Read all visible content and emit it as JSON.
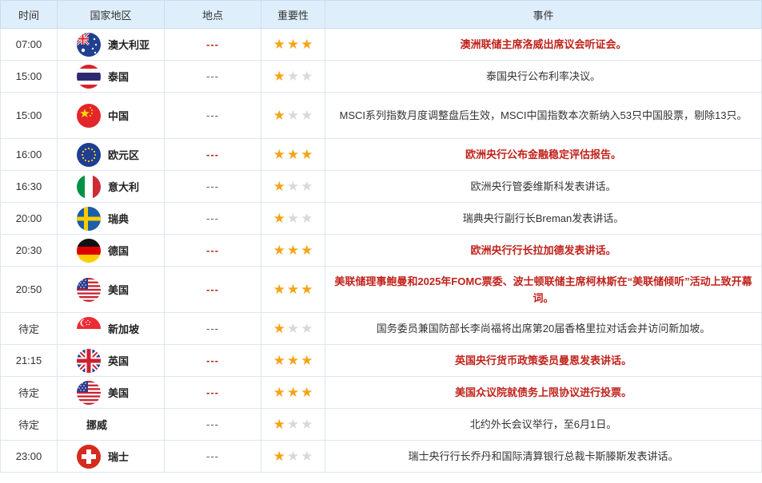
{
  "headers": {
    "time": "时间",
    "country": "国家地区",
    "place": "地点",
    "importance": "重要性",
    "event": "事件"
  },
  "rows": [
    {
      "time": "07:00",
      "country": "澳大利亚",
      "flag": "australia-flag-icon",
      "place": "---",
      "stars": 3,
      "event": "澳洲联储主席洛威出席议会听证会。",
      "highlight": true
    },
    {
      "time": "15:00",
      "country": "泰国",
      "flag": "thailand-flag-icon",
      "place": "---",
      "stars": 1,
      "event": "泰国央行公布利率决议。",
      "highlight": false
    },
    {
      "time": "15:00",
      "country": "中国",
      "flag": "china-flag-icon",
      "place": "---",
      "stars": 1,
      "event": "MSCI系列指数月度调整盘后生效，MSCI中国指数本次新纳入53只中国股票，剔除13只。",
      "highlight": false
    },
    {
      "time": "16:00",
      "country": "欧元区",
      "flag": "eu-flag-icon",
      "place": "---",
      "stars": 3,
      "event": "欧洲央行公布金融稳定评估报告。",
      "highlight": true
    },
    {
      "time": "16:30",
      "country": "意大利",
      "flag": "italy-flag-icon",
      "place": "---",
      "stars": 1,
      "event": "欧洲央行管委维斯科发表讲话。",
      "highlight": false
    },
    {
      "time": "20:00",
      "country": "瑞典",
      "flag": "sweden-flag-icon",
      "place": "---",
      "stars": 1,
      "event": "瑞典央行副行长Breman发表讲话。",
      "highlight": false
    },
    {
      "time": "20:30",
      "country": "德国",
      "flag": "germany-flag-icon",
      "place": "---",
      "stars": 3,
      "event": "欧洲央行行长拉加德发表讲话。",
      "highlight": true
    },
    {
      "time": "20:50",
      "country": "美国",
      "flag": "usa-flag-icon",
      "place": "---",
      "stars": 3,
      "event": "美联储理事鲍曼和2025年FOMC票委、波士顿联储主席柯林斯在“美联储倾听”活动上致开幕词。",
      "highlight": true
    },
    {
      "time": "待定",
      "country": "新加坡",
      "flag": "singapore-flag-icon",
      "place": "---",
      "stars": 1,
      "event": "国务委员兼国防部长李尚福将出席第20届香格里拉对话会并访问新加坡。",
      "highlight": false
    },
    {
      "time": "21:15",
      "country": "英国",
      "flag": "uk-flag-icon",
      "place": "---",
      "stars": 3,
      "event": "英国央行货币政策委员曼恩发表讲话。",
      "highlight": true
    },
    {
      "time": "待定",
      "country": "美国",
      "flag": "usa-flag-icon",
      "place": "---",
      "stars": 3,
      "event": "美国众议院就债务上限协议进行投票。",
      "highlight": true
    },
    {
      "time": "待定",
      "country": "挪威",
      "flag": "",
      "place": "---",
      "stars": 1,
      "event": "北约外长会议举行，至6月1日。",
      "highlight": false
    },
    {
      "time": "23:00",
      "country": "瑞士",
      "flag": "switzerland-flag-icon",
      "place": "---",
      "stars": 1,
      "event": "瑞士央行行长乔丹和国际清算银行总裁卡斯滕斯发表讲话。",
      "highlight": false
    }
  ],
  "colors": {
    "header_bg": "#dfeefb",
    "highlight_text": "#c0221b",
    "star_on": "#f4a416",
    "star_off": "#d9d9d9"
  }
}
